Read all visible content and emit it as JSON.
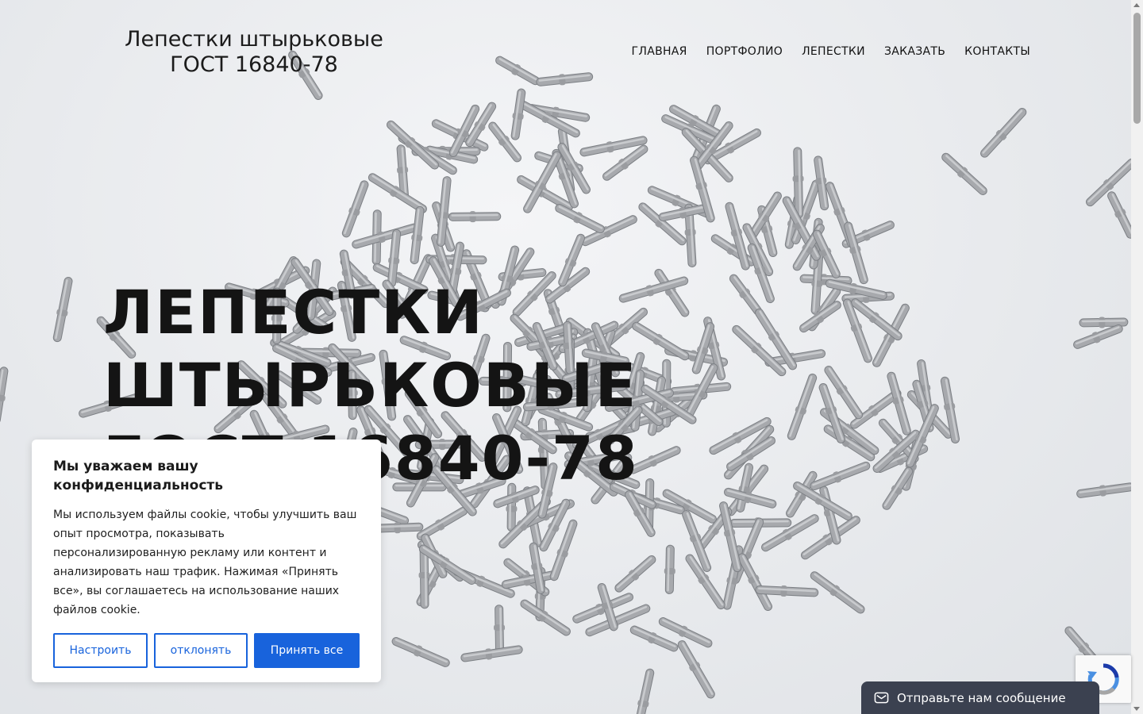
{
  "header": {
    "site_title_line1": "Лепестки штырьковые",
    "site_title_line2": "ГОСТ 16840-78"
  },
  "nav": [
    {
      "label": "ГЛАВНАЯ"
    },
    {
      "label": "ПОРТФОЛИО"
    },
    {
      "label": "ЛЕПЕСТКИ"
    },
    {
      "label": "ЗАКАЗАТЬ"
    },
    {
      "label": "КОНТАКТЫ"
    }
  ],
  "hero": {
    "heading_line1": "ЛЕПЕСТКИ",
    "heading_line2": "ШТЫРЬКОВЫЕ",
    "heading_line3": "ГОСТ 16840-78"
  },
  "cookie_banner": {
    "title": "Мы уважаем вашу конфиденциальность",
    "text": "Мы используем файлы cookie, чтобы улучшить ваш опыт просмотра, показывать персонализированную рекламу или контент и анализировать наш трафик. Нажимая «Принять все», вы соглашаетесь на использование наших файлов cookie.",
    "customize_label": "Настроить",
    "reject_label": "отклонять",
    "accept_label": "Принять все"
  },
  "chat_widget": {
    "label": "Отправьте нам сообщение",
    "icon": "envelope-icon"
  },
  "colors": {
    "accent": "#1863dc",
    "chat_bg": "#3b4150"
  }
}
